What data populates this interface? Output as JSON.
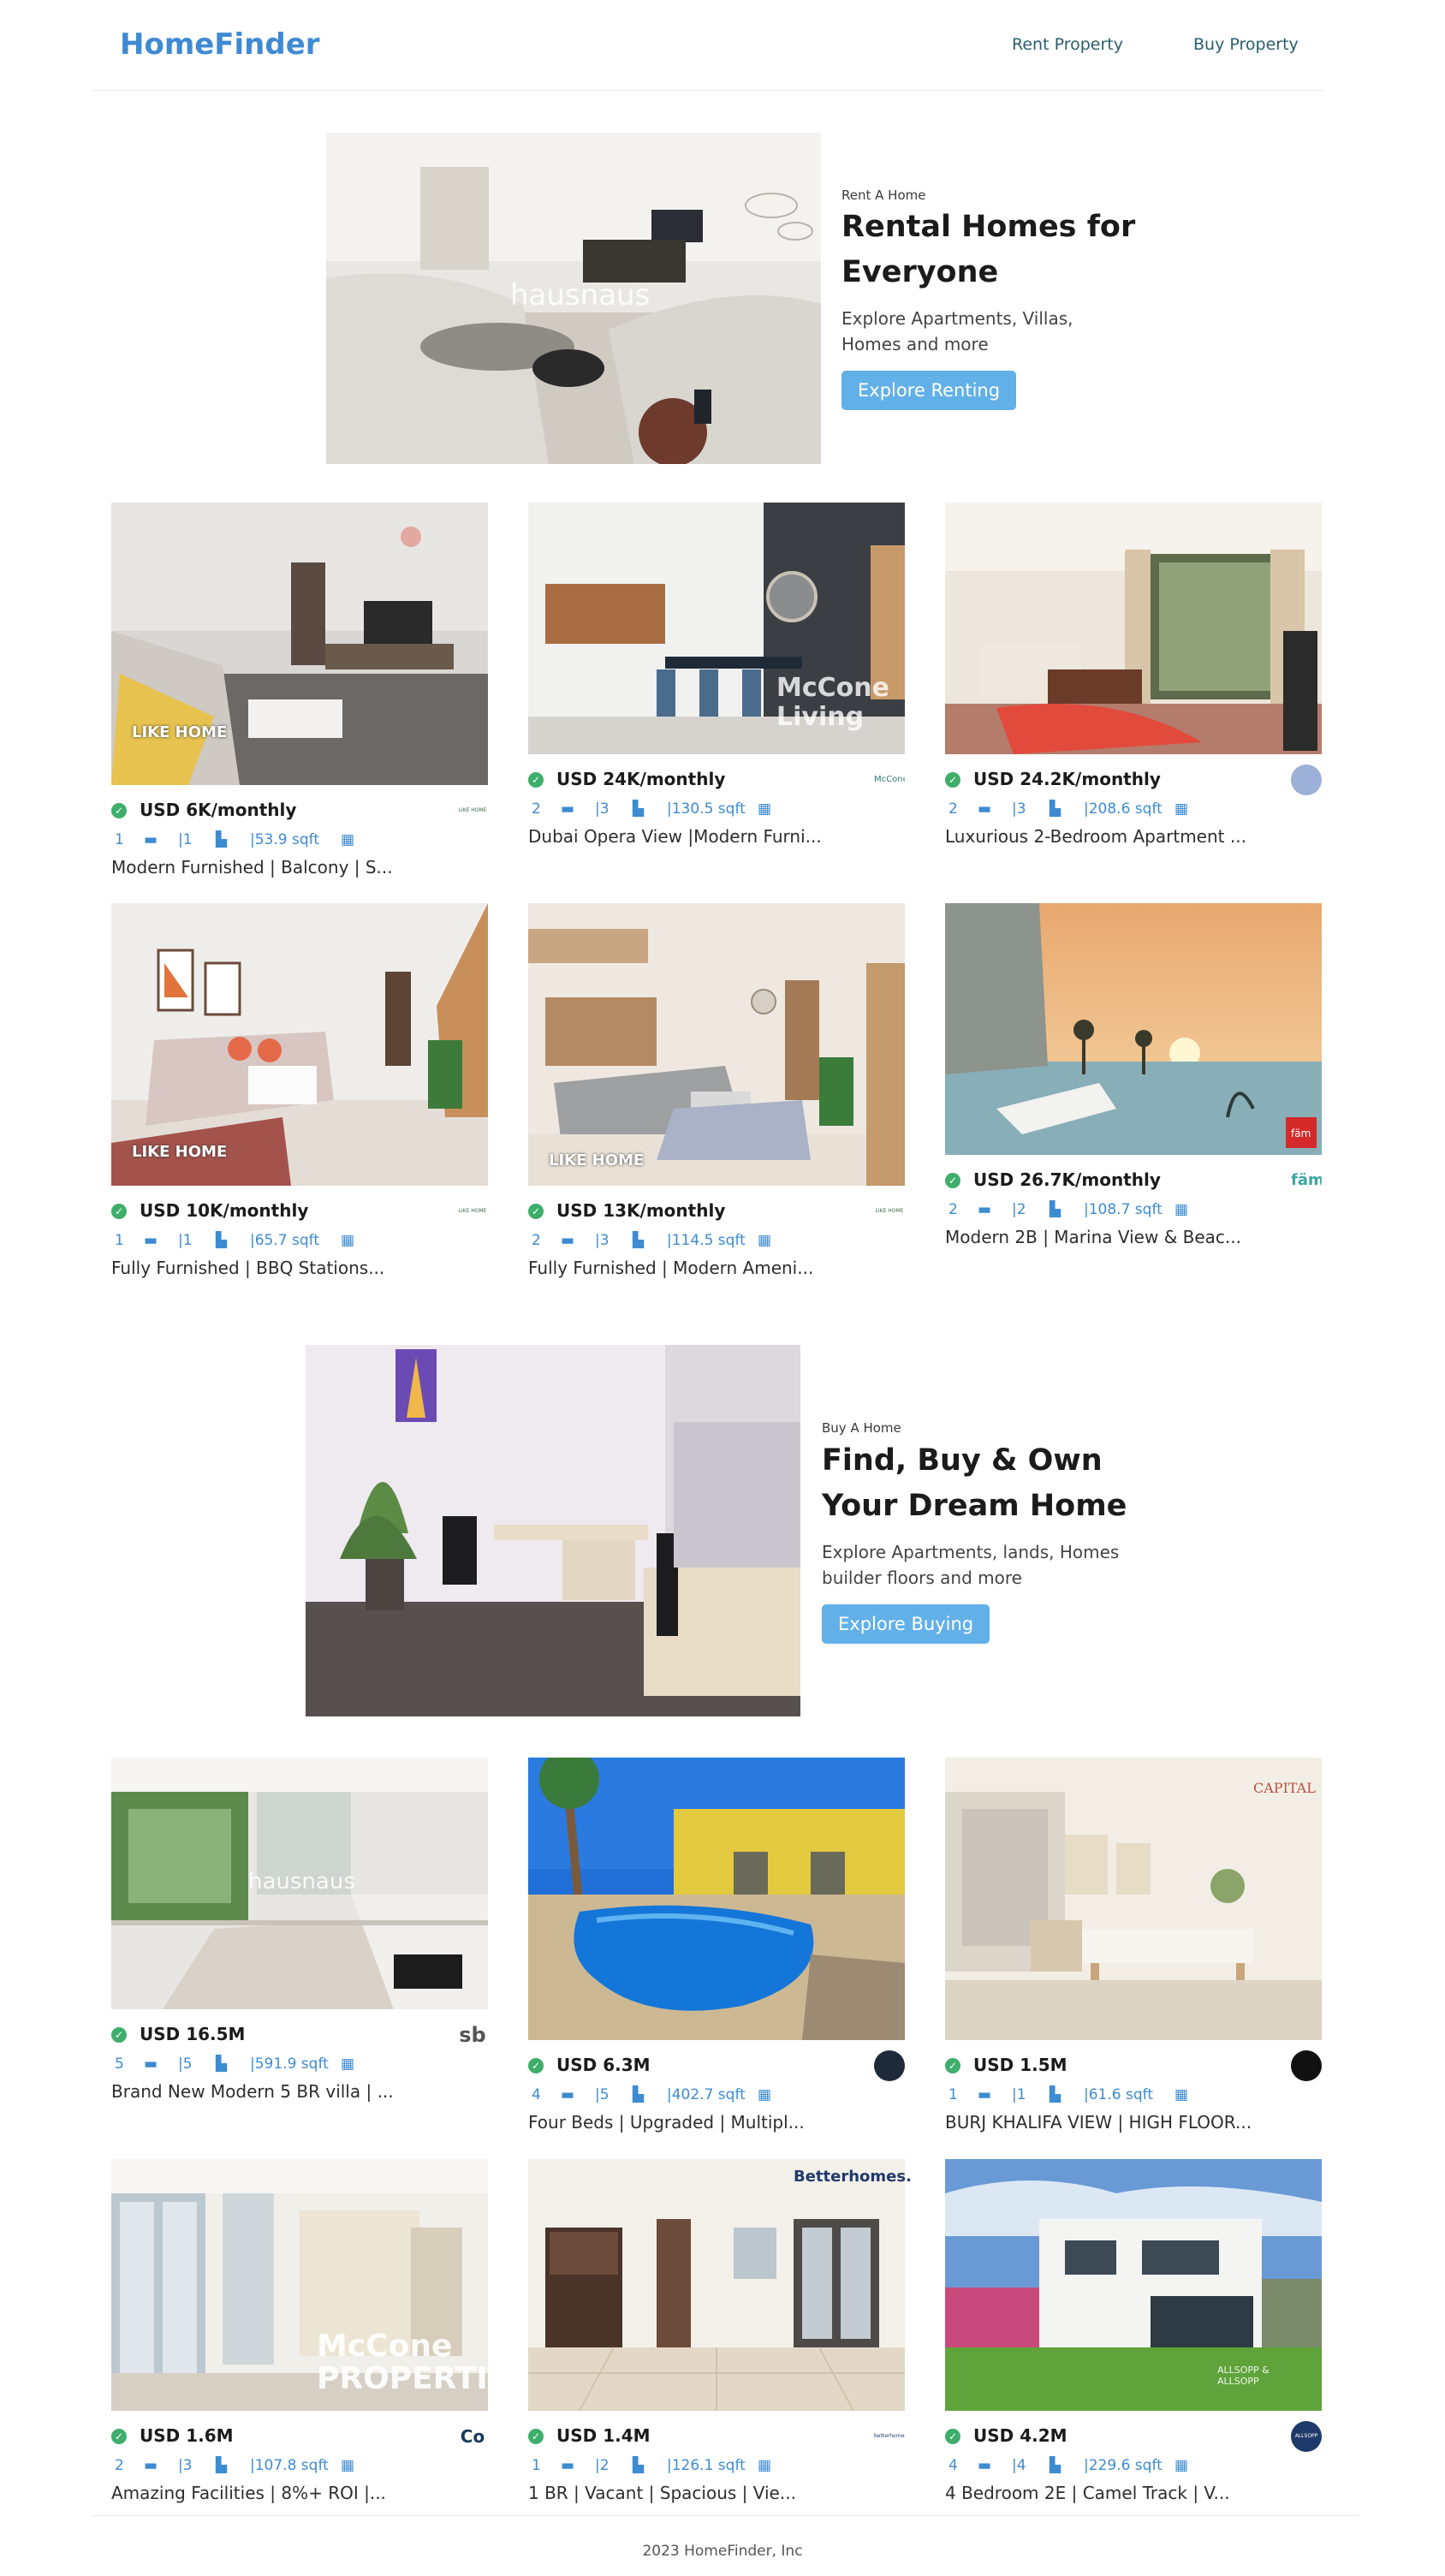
{
  "brand": "HomeFinder",
  "nav": {
    "rent": "Rent Property",
    "buy": "Buy Property"
  },
  "rent_hero": {
    "eyebrow": "Rent A Home",
    "title": "Rental Homes for Everyone",
    "desc": "Explore Apartments, Villas, Homes and more",
    "button": "Explore Renting",
    "watermark": "hausnaus"
  },
  "buy_hero": {
    "eyebrow": "Buy A Home",
    "title": "Find, Buy & Own Your Dream Home",
    "desc": "Explore Apartments, lands, Homes builder floors and more",
    "button": "Explore Buying"
  },
  "rent_listings": [
    {
      "price": "USD 6K/monthly",
      "beds": "1",
      "baths": "|1",
      "area": "|53.9 sqft",
      "title": "Modern Furnished | Balcony | S...",
      "watermark": "LIKE HOME",
      "agent": "LIKE HOME"
    },
    {
      "price": "USD 24K/monthly",
      "beds": "2",
      "baths": "|3",
      "area": "|130.5 sqft",
      "title": "Dubai Opera View |Modern Furni...",
      "watermark": "McCone Living",
      "agent": "McCone"
    },
    {
      "price": "USD 24.2K/monthly",
      "beds": "2",
      "baths": "|3",
      "area": "|208.6 sqft",
      "title": "Luxurious 2-Bedroom Apartment ...",
      "watermark": "",
      "agent": ""
    },
    {
      "price": "USD 10K/monthly",
      "beds": "1",
      "baths": "|1",
      "area": "|65.7 sqft",
      "title": "Fully Furnished | BBQ Stations...",
      "watermark": "LIKE HOME",
      "agent": "LIKE HOME"
    },
    {
      "price": "USD 13K/monthly",
      "beds": "2",
      "baths": "|3",
      "area": "|114.5 sqft",
      "title": "Fully Furnished | Modern Ameni...",
      "watermark": "LIKE HOME",
      "agent": "LIKE HOME"
    },
    {
      "price": "USD 26.7K/monthly",
      "beds": "2",
      "baths": "|2",
      "area": "|108.7 sqft",
      "title": "Modern 2B | Marina View & Beac...",
      "watermark": "fäm",
      "agent": "fäm"
    }
  ],
  "buy_listings": [
    {
      "price": "USD 16.5M",
      "beds": "5",
      "baths": "|5",
      "area": "|591.9 sqft",
      "title": "Brand New Modern 5 BR villa | ...",
      "watermark": "hausnaus",
      "agent": "sb"
    },
    {
      "price": "USD 6.3M",
      "beds": "4",
      "baths": "|5",
      "area": "|402.7 sqft",
      "title": "Four Beds | Upgraded | Multipl...",
      "watermark": "",
      "agent": ""
    },
    {
      "price": "USD 1.5M",
      "beds": "1",
      "baths": "|1",
      "area": "|61.6 sqft",
      "title": "BURJ KHALIFA VIEW | HIGH FLOOR...",
      "watermark": "CAPITAL",
      "agent": ""
    },
    {
      "price": "USD 1.6M",
      "beds": "2",
      "baths": "|3",
      "area": "|107.8 sqft",
      "title": "Amazing Facilities | 8%+ ROI |...",
      "watermark": "McCone PROPERTIES",
      "agent": "Co"
    },
    {
      "price": "USD 1.4M",
      "beds": "1",
      "baths": "|2",
      "area": "|126.1 sqft",
      "title": "1 BR | Vacant | Spacious | Vie...",
      "watermark": "Betterhomes.",
      "agent": "betterhomes"
    },
    {
      "price": "USD 4.2M",
      "beds": "4",
      "baths": "|4",
      "area": "|229.6 sqft",
      "title": "4 Bedroom 2E | Camel Track | V...",
      "watermark": "ALLSOPP & ALLSOPP",
      "agent": "ALLSOPP"
    }
  ],
  "footer": "2023 HomeFinder, Inc",
  "colors": {
    "brand": "#3f8ad3",
    "button": "#62b0e8",
    "verified": "#3fae6b",
    "feature": "#3d8bd1"
  }
}
